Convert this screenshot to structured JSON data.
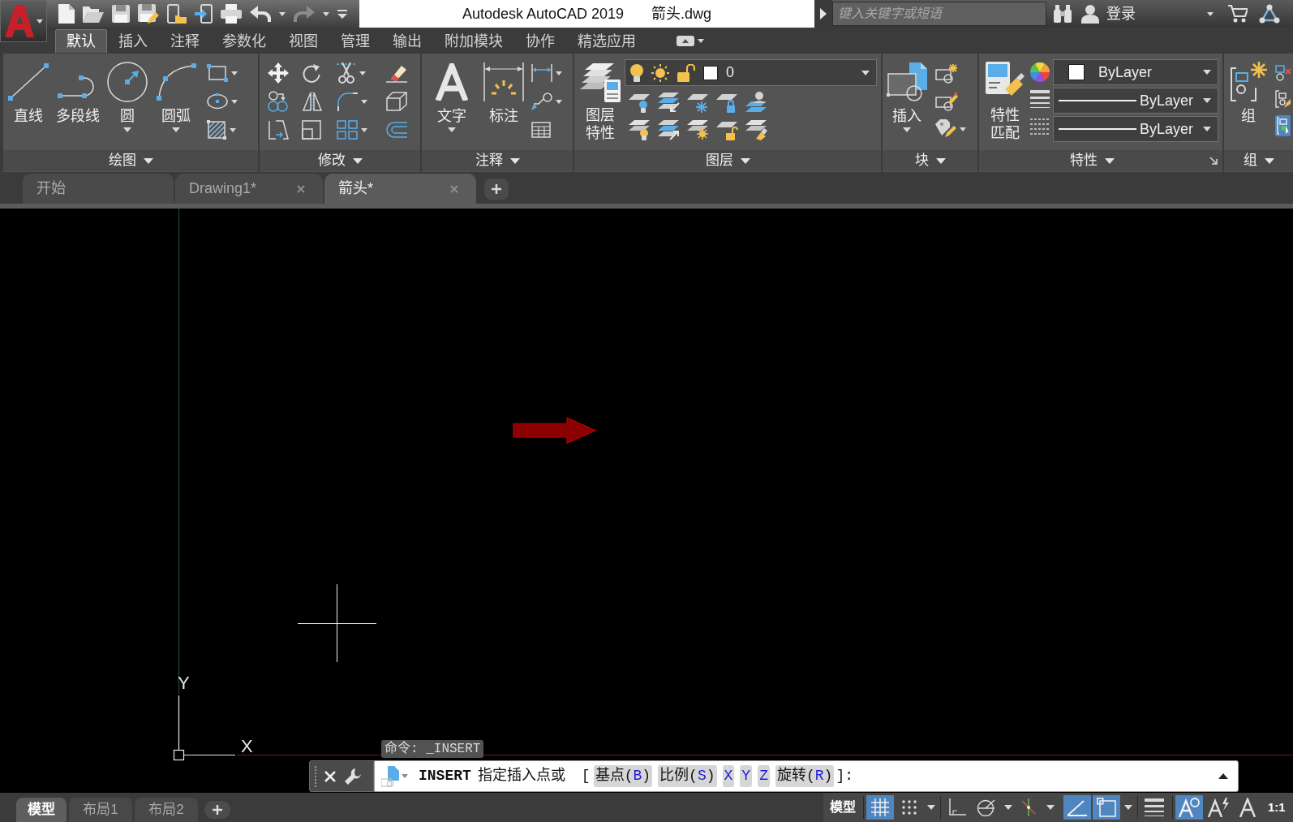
{
  "title_bar": {
    "app_title": "Autodesk AutoCAD 2019",
    "file_name": "箭头.dwg"
  },
  "search": {
    "placeholder": "键入关键字或短语"
  },
  "account": {
    "sign_in": "登录"
  },
  "ribbon": {
    "tabs": [
      {
        "label": "默认",
        "selected": true
      },
      {
        "label": "插入",
        "selected": false
      },
      {
        "label": "注释",
        "selected": false
      },
      {
        "label": "参数化",
        "selected": false
      },
      {
        "label": "视图",
        "selected": false
      },
      {
        "label": "管理",
        "selected": false
      },
      {
        "label": "输出",
        "selected": false
      },
      {
        "label": "附加模块",
        "selected": false
      },
      {
        "label": "协作",
        "selected": false
      },
      {
        "label": "精选应用",
        "selected": false
      }
    ],
    "panels": [
      {
        "kind": "draw",
        "title": "绘图",
        "tools": [
          {
            "label": "直线",
            "menu": false
          },
          {
            "label": "多段线",
            "menu": false
          },
          {
            "label": "圆",
            "menu": true
          },
          {
            "label": "圆弧",
            "menu": true
          }
        ]
      },
      {
        "kind": "modify",
        "title": "修改"
      },
      {
        "kind": "annotate",
        "title": "注释",
        "tools": [
          {
            "label": "文字",
            "menu": true
          },
          {
            "label": "标注",
            "menu": false
          }
        ]
      },
      {
        "kind": "layers",
        "title": "图层",
        "tools": [
          {
            "label": "图层特性",
            "menu": false
          }
        ],
        "layer": "0"
      },
      {
        "kind": "block",
        "title": "块",
        "tools": [
          {
            "label": "插入",
            "menu": true
          }
        ]
      },
      {
        "kind": "properties",
        "title": "特性",
        "tools": [
          {
            "label": "特性匹配",
            "menu": false
          }
        ],
        "combos": [
          {
            "kind": "swatch",
            "value": "ByLayer"
          },
          {
            "kind": "line",
            "value": "ByLayer"
          },
          {
            "kind": "line",
            "value": "ByLayer"
          }
        ]
      },
      {
        "kind": "group",
        "title": "组",
        "tools": [
          {
            "label": "组",
            "menu": false
          }
        ]
      }
    ]
  },
  "doc_tabs": [
    {
      "label": "开始",
      "selected": false,
      "closable": false
    },
    {
      "label": "Drawing1*",
      "selected": false,
      "closable": true
    },
    {
      "label": "箭头*",
      "selected": true,
      "closable": true
    }
  ],
  "canvas": {
    "ucs": {
      "y_label": "Y",
      "x_label": "X"
    },
    "command_history": "命令: _INSERT"
  },
  "command_line": {
    "command": "INSERT",
    "prompt": "指定插入点或",
    "open": "[",
    "options": [
      {
        "label": "基点(",
        "key": "B",
        "close": ")"
      },
      {
        "label": "比例(",
        "key": "S",
        "close": ")"
      },
      {
        "key": "X"
      },
      {
        "key": "Y"
      },
      {
        "key": "Z"
      },
      {
        "label": "旋转(",
        "key": "R",
        "close": ")"
      }
    ],
    "end": "]:"
  },
  "layout_tabs": [
    {
      "label": "模型",
      "selected": true
    },
    {
      "label": "布局1",
      "selected": false
    },
    {
      "label": "布局2",
      "selected": false
    }
  ],
  "status_bar": {
    "space": "模型",
    "toggles": [
      {
        "on": true
      },
      {
        "on": false
      },
      {
        "on": false
      },
      {
        "on": false
      },
      {
        "on": false
      },
      {
        "on": true
      },
      {
        "on": true
      },
      {
        "on": false
      },
      {
        "on": true
      },
      {
        "on": false
      },
      {
        "on": false
      }
    ],
    "scale": "1:1"
  }
}
